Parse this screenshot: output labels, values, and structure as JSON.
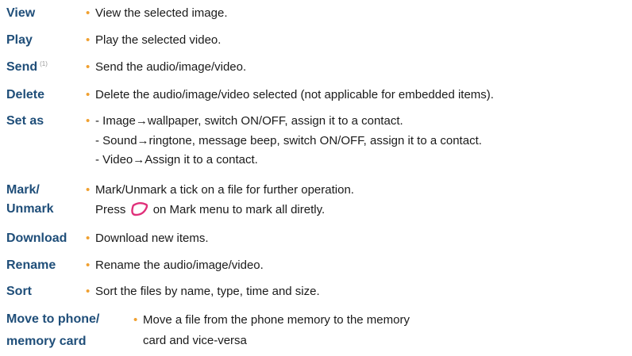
{
  "colors": {
    "term": "#1f4e79",
    "bullet": "#f0a030",
    "text": "#1a1a1a",
    "key_icon": "#e0307a"
  },
  "bullet_char": "•",
  "items": [
    {
      "term": "View",
      "desc": "View the selected image."
    },
    {
      "term": "Play",
      "desc": "Play the selected video."
    },
    {
      "term": "Send",
      "mark": "(1)",
      "desc": "Send the audio/image/video."
    },
    {
      "term": "Delete",
      "desc": "Delete the audio/image/video selected (not applicable for embedded items)."
    },
    {
      "term": "Set as",
      "lines": [
        "- Image→wallpaper, switch ON/OFF, assign it to a contact.",
        "- Sound→ringtone, message beep, switch ON/OFF, assign it to a contact.",
        "- Video→Assign it to a contact."
      ]
    },
    {
      "term_lines": [
        "Mark/",
        "Unmark"
      ],
      "desc": "Mark/Unmark a tick on a file for further operation.",
      "desc2_before": "Press",
      "desc2_icon": "navigation-key-icon",
      "desc2_after": "on Mark menu to mark all diretly."
    },
    {
      "term": "Download",
      "desc": "Download new items."
    },
    {
      "term": "Rename",
      "desc": "Rename the audio/image/video."
    },
    {
      "term": "Sort",
      "desc": "Sort the files by name, type, time and size."
    },
    {
      "term_lines": [
        "Move to phone/",
        "memory card"
      ],
      "lines": [
        "Move a file from the phone memory to the memory",
        "card and vice-versa"
      ]
    }
  ]
}
